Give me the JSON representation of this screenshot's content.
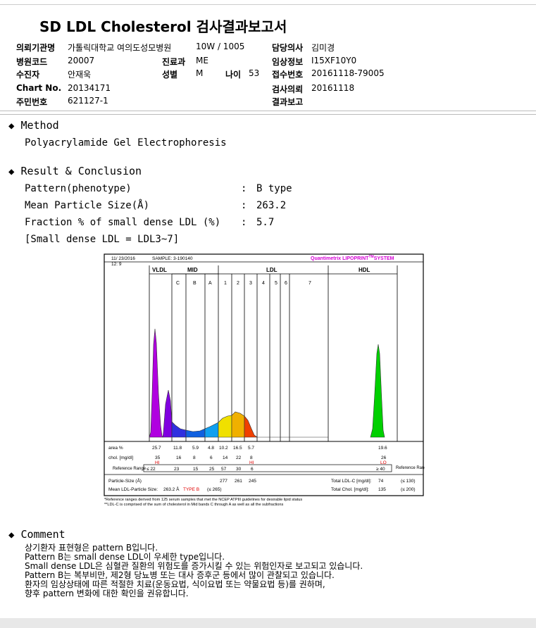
{
  "report": {
    "title": "SD LDL Cholesterol 검사결과보고서"
  },
  "header": {
    "institution_label": "의뢰기관명",
    "institution_value": "가톨릭대학교 여의도성모병원",
    "ward_value": "10W / 1005",
    "doctor_label": "담당의사",
    "doctor_value": "김미경",
    "hospital_code_label": "병원코드",
    "hospital_code_value": "20007",
    "dept_label": "진료과",
    "dept_value": "ME",
    "clinical_label": "임상정보",
    "clinical_value": "I15XF10Y0",
    "patient_label": "수진자",
    "patient_value": "안재욱",
    "sex_label": "성별",
    "sex_value": "M",
    "age_label": "나이",
    "age_value": "53",
    "accession_label": "접수번호",
    "accession_value": "20161118-79005",
    "chart_label": "Chart No.",
    "chart_value": "20134171",
    "request_label": "검사의뢰",
    "request_value": "20161118",
    "id_label": "주민번호",
    "id_value": "621127-1",
    "report_label": "결과보고"
  },
  "method": {
    "heading": "Method",
    "text": "Polyacrylamide Gel Electrophoresis"
  },
  "result": {
    "heading": "Result & Conclusion",
    "rows": [
      {
        "label": "Pattern(phenotype)",
        "colon": ":",
        "value": "B type"
      },
      {
        "label": "Mean Particle Size(Å)",
        "colon": ":",
        "value": "263.2"
      },
      {
        "label": "Fraction % of small dense LDL (%)",
        "colon": ":",
        "value": "5.7"
      }
    ],
    "note": "[Small dense LDL = LDL3~7]"
  },
  "chart_data": {
    "type": "area",
    "date": "11/ 23/2016",
    "time": "12: 9",
    "sample": "SAMPLE:   3-190140",
    "brand": "Quantimetrix LIPOPRINT",
    "brand_tm": "TM",
    "brand_system": "SYSTEM",
    "regions": [
      "VLDL",
      "MID",
      "LDL",
      "HDL"
    ],
    "subbands": [
      "C",
      "B",
      "A",
      "1",
      "2",
      "3",
      "4",
      "5",
      "6",
      "7"
    ],
    "table": {
      "area_label": "area %",
      "area": [
        "25.7",
        "11.8",
        "5.9",
        "4.8",
        "10.2",
        "16.5",
        "5.7",
        "19.6"
      ],
      "chol_label": "chol. [mg/dl]",
      "chol": [
        "35",
        "16",
        "8",
        "6",
        "14",
        "22",
        "8",
        "26"
      ],
      "chol_flags": [
        "HI",
        "HI",
        "LO"
      ],
      "ref_label": "Reference Range",
      "ref": [
        "≤ 22",
        "23",
        "15",
        "25",
        "57",
        "30",
        "6",
        "≥ 40"
      ],
      "size_label": "Particle-Size (Å)",
      "sizes": [
        "277",
        "261",
        "245"
      ],
      "mean_size_label": "Mean LDL-Particle Size:",
      "mean_size_value": "263.2 Å",
      "mean_size_type": "TYPE B",
      "mean_size_ref": "(≤ 265)",
      "total_ldl_label": "Total LDL-C [mg/dl]:",
      "total_ldl_value": "74",
      "total_ldl_ref": "(≤ 130)",
      "total_chol_label": "Total Chol. [mg/dl]:",
      "total_chol_value": "135",
      "total_chol_ref": "(≤ 200)"
    },
    "footnotes": [
      "*Reference ranges derived from 125 serum samples that met the NCEP ATPIII guidelines for desirable lipid status",
      "**LDL-C is comprised of the sum of cholesterol in Mid bands C through A as well as all the subfractions"
    ]
  },
  "comment": {
    "heading": "Comment",
    "lines": [
      "상기환자 표현형은 pattern B입니다.",
      "Pattern B는 small dense LDL이 우세한 type입니다.",
      "Small dense LDL은 심혈관 질환의 위험도를 증가시킬 수 있는 위험인자로 보고되고 있습니다.",
      "Pattern B는 복부비만, 제2형 당뇨병 또는 대사 증후군 등에서 많이 관찰되고 있습니다.",
      "환자의 임상상태에 따른 적절한 치료(운동요법, 식이요법 또는 약물요법 등)를 권하며,",
      "향후 pattern 변화에 대한 확인을 권유합니다."
    ]
  }
}
